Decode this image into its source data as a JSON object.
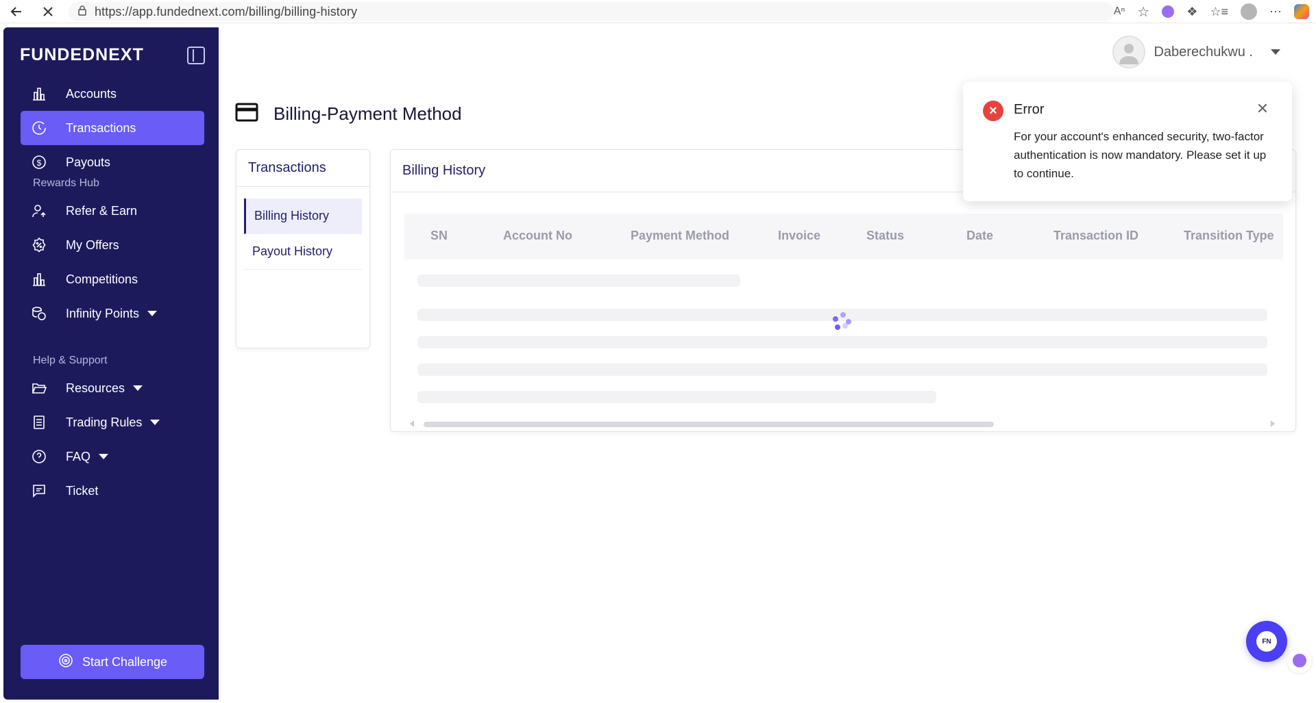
{
  "browser": {
    "url": "https://app.fundednext.com/billing/billing-history"
  },
  "sidebar": {
    "logo": "FUNDEDNEXT",
    "items_main": [
      {
        "label": "Accounts",
        "icon": "bar-chart-icon"
      },
      {
        "label": "Transactions",
        "icon": "clock-history-icon",
        "active": true
      },
      {
        "label": "Payouts",
        "icon": "dollar-circle-icon"
      }
    ],
    "rewards_label": "Rewards Hub",
    "items_rewards": [
      {
        "label": "Refer & Earn",
        "icon": "user-share-icon"
      },
      {
        "label": "My Offers",
        "icon": "discount-badge-icon"
      },
      {
        "label": "Competitions",
        "icon": "bar-chart-icon"
      },
      {
        "label": "Infinity Points",
        "icon": "coins-icon",
        "dropdown": true
      }
    ],
    "support_label": "Help & Support",
    "items_support": [
      {
        "label": "Resources",
        "icon": "folder-icon",
        "dropdown": true
      },
      {
        "label": "Trading Rules",
        "icon": "document-icon",
        "dropdown": true
      },
      {
        "label": "FAQ",
        "icon": "question-icon",
        "dropdown": true
      },
      {
        "label": "Ticket",
        "icon": "message-icon"
      }
    ],
    "start_button": "Start Challenge"
  },
  "header": {
    "user_name": "Daberechukwu ."
  },
  "page": {
    "title": "Billing-Payment Method"
  },
  "transactions_card": {
    "title": "Transactions",
    "links": [
      "Billing History",
      "Payout History"
    ]
  },
  "billing_card": {
    "title": "Billing History",
    "columns": [
      "SN",
      "Account No",
      "Payment Method",
      "Invoice",
      "Status",
      "Date",
      "Transaction ID",
      "Transition Type"
    ]
  },
  "toast": {
    "title": "Error",
    "message": "For your account's enhanced security, two-factor authentication is now mandatory. Please set it up to continue."
  },
  "colors": {
    "sidebar": "#1d1a5c",
    "accent": "#6a5cf6",
    "error": "#e8423f"
  }
}
